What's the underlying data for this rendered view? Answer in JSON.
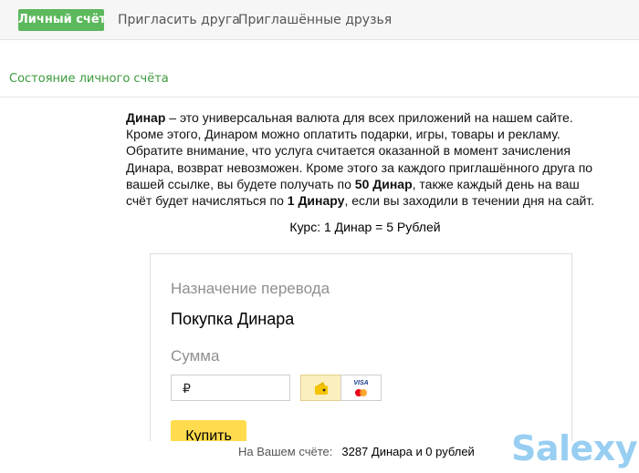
{
  "tabs": [
    {
      "label": "Личный счёт",
      "active": true
    },
    {
      "label": "Пригласить друга",
      "active": false
    },
    {
      "label": "Приглашённые друзья",
      "active": false
    }
  ],
  "section": {
    "title": "Состояние личного счёта"
  },
  "description": {
    "segments": [
      {
        "text": "Динар",
        "bold": true
      },
      {
        "text": " – это универсальная валюта для всех приложений на нашем сайте. Кроме этого, Динаром можно оплатить подарки, игры, товары и рекламу. Обратите внимание, что услуга считается оказанной в момент зачисления Динара, возврат невозможен. Кроме этого за каждого приглашённого друга по вашей ссылке, вы будете получать по ",
        "bold": false
      },
      {
        "text": "50 Динар",
        "bold": true
      },
      {
        "text": ", также каждый день на ваш счёт будет начисляться по ",
        "bold": false
      },
      {
        "text": "1 Динару",
        "bold": true
      },
      {
        "text": ", если вы заходили в течении дня на сайт.",
        "bold": false
      }
    ]
  },
  "rate": "Курс: 1 Динар = 5 Рублей",
  "form": {
    "purpose_label": "Назначение перевода",
    "purpose_value": "Покупка Динара",
    "amount_label": "Сумма",
    "amount_value": "",
    "amount_placeholder": "₽",
    "card_brand": "VISA",
    "buy_label": "Купить",
    "accent_color": "#ffdb4d"
  },
  "balance": {
    "label": "На Вашем счёте:",
    "value": "3287 Динара и 0 рублей"
  },
  "watermark": "Salexy"
}
